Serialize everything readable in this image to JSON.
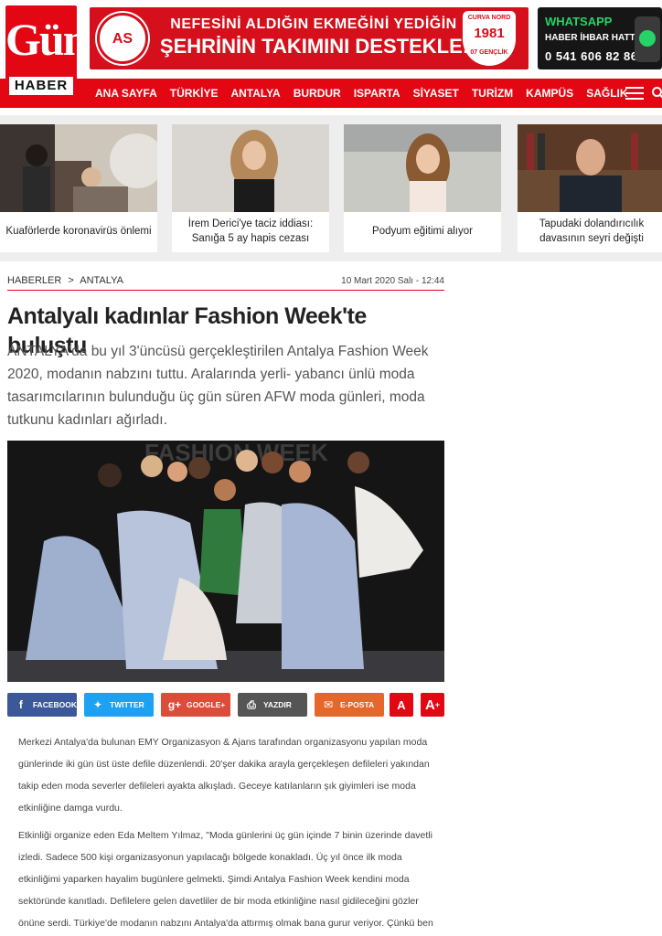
{
  "logo": {
    "line1": "Gün",
    "line2": "HABER"
  },
  "banner": {
    "club": "AS",
    "line1": "NEFESİNİ ALDIĞIN EKMEĞİNİ YEDİĞİN",
    "line2": "ŞEHRİNİN TAKIMINI DESTEKLE!",
    "badge_top": "CURVA NORD",
    "badge_year": "1981",
    "badge_bottom": "07 GENÇLİK"
  },
  "whatsapp": {
    "title": "WHATSAPP",
    "subtitle": "HABER İHBAR HATTI",
    "phone": "0 541 606 82 86"
  },
  "nav": {
    "items": [
      "ANA SAYFA",
      "TÜRKİYE",
      "ANTALYA",
      "BURDUR",
      "ISPARTA",
      "SİYASET",
      "TURİZM",
      "KAMPÜS",
      "SAĞLIK"
    ]
  },
  "cards": [
    {
      "caption": "Kuaförlerde koronavirüs önlemi"
    },
    {
      "caption": "İrem Derici'ye taciz iddiası: Sanığa 5 ay hapis cezası"
    },
    {
      "caption": "Podyum eğitimi alıyor"
    },
    {
      "caption": "Tapudaki dolandırıcılık davasının seyri değişti"
    }
  ],
  "article": {
    "breadcrumb": [
      "HABERLER",
      ">",
      "ANTALYA"
    ],
    "date": "10 Mart 2020 Salı - 12:44",
    "title": "Antalyalı kadınlar Fashion Week'te buluştu",
    "lead": "ANTALYA'da bu yıl 3'üncüsü gerçekleştirilen Antalya Fashion Week 2020, modanın nabzını tuttu. Aralarında yerli- yabancı ünlü moda tasarımcılarının bulunduğu üç gün süren AFW moda günleri, moda tutkunu kadınları ağırladı.",
    "photo_sign": "FASHION WEEK",
    "paragraphs": [
      "Merkezi Antalya'da bulunan EMY Organizasyon & Ajans tarafından organizasyonu yapılan moda günlerinde iki gün üst üste defile düzenlendi. 20'şer dakika arayla gerçekleşen defileleri yakından takip eden moda severler defileleri ayakta alkışladı. Geceye katılanların şık giyimleri ise moda etkinliğine damga vurdu.",
      "Etkinliği organize eden Eda Meltem Yılmaz, \"Moda günlerini üç gün içinde 7 binin üzerinde davetli izledi. Sadece 500 kişi organizasyonun yapılacağı bölgede konakladı. Üç yıl önce ilk moda etkinliğimi yaparken hayalim bugünlere gelmekti. Şimdi Antalya Fashion Week kendini moda sektöründe kanıtladı. Defilelere gelen davetliler de bir moda etkinliğine nasıl gidileceğini gözler önüne serdi. Türkiye'de modanın nabzını Antalya'da attırmış olmak bana gurur veriyor. Çünkü ben bir Antalyalıyım\" diye konuştu."
    ]
  },
  "share": {
    "facebook": "FACEBOOK",
    "twitter": "TWITTER",
    "google": "GOOGLE+",
    "print": "YAZDIR",
    "email": "E-POSTA",
    "font_small": "A",
    "font_plus": "+"
  },
  "colors": {
    "brand_red": "#e30613",
    "facebook": "#3b5998",
    "twitter": "#1da1f2",
    "google": "#dd4b39",
    "email": "#e6672b"
  }
}
